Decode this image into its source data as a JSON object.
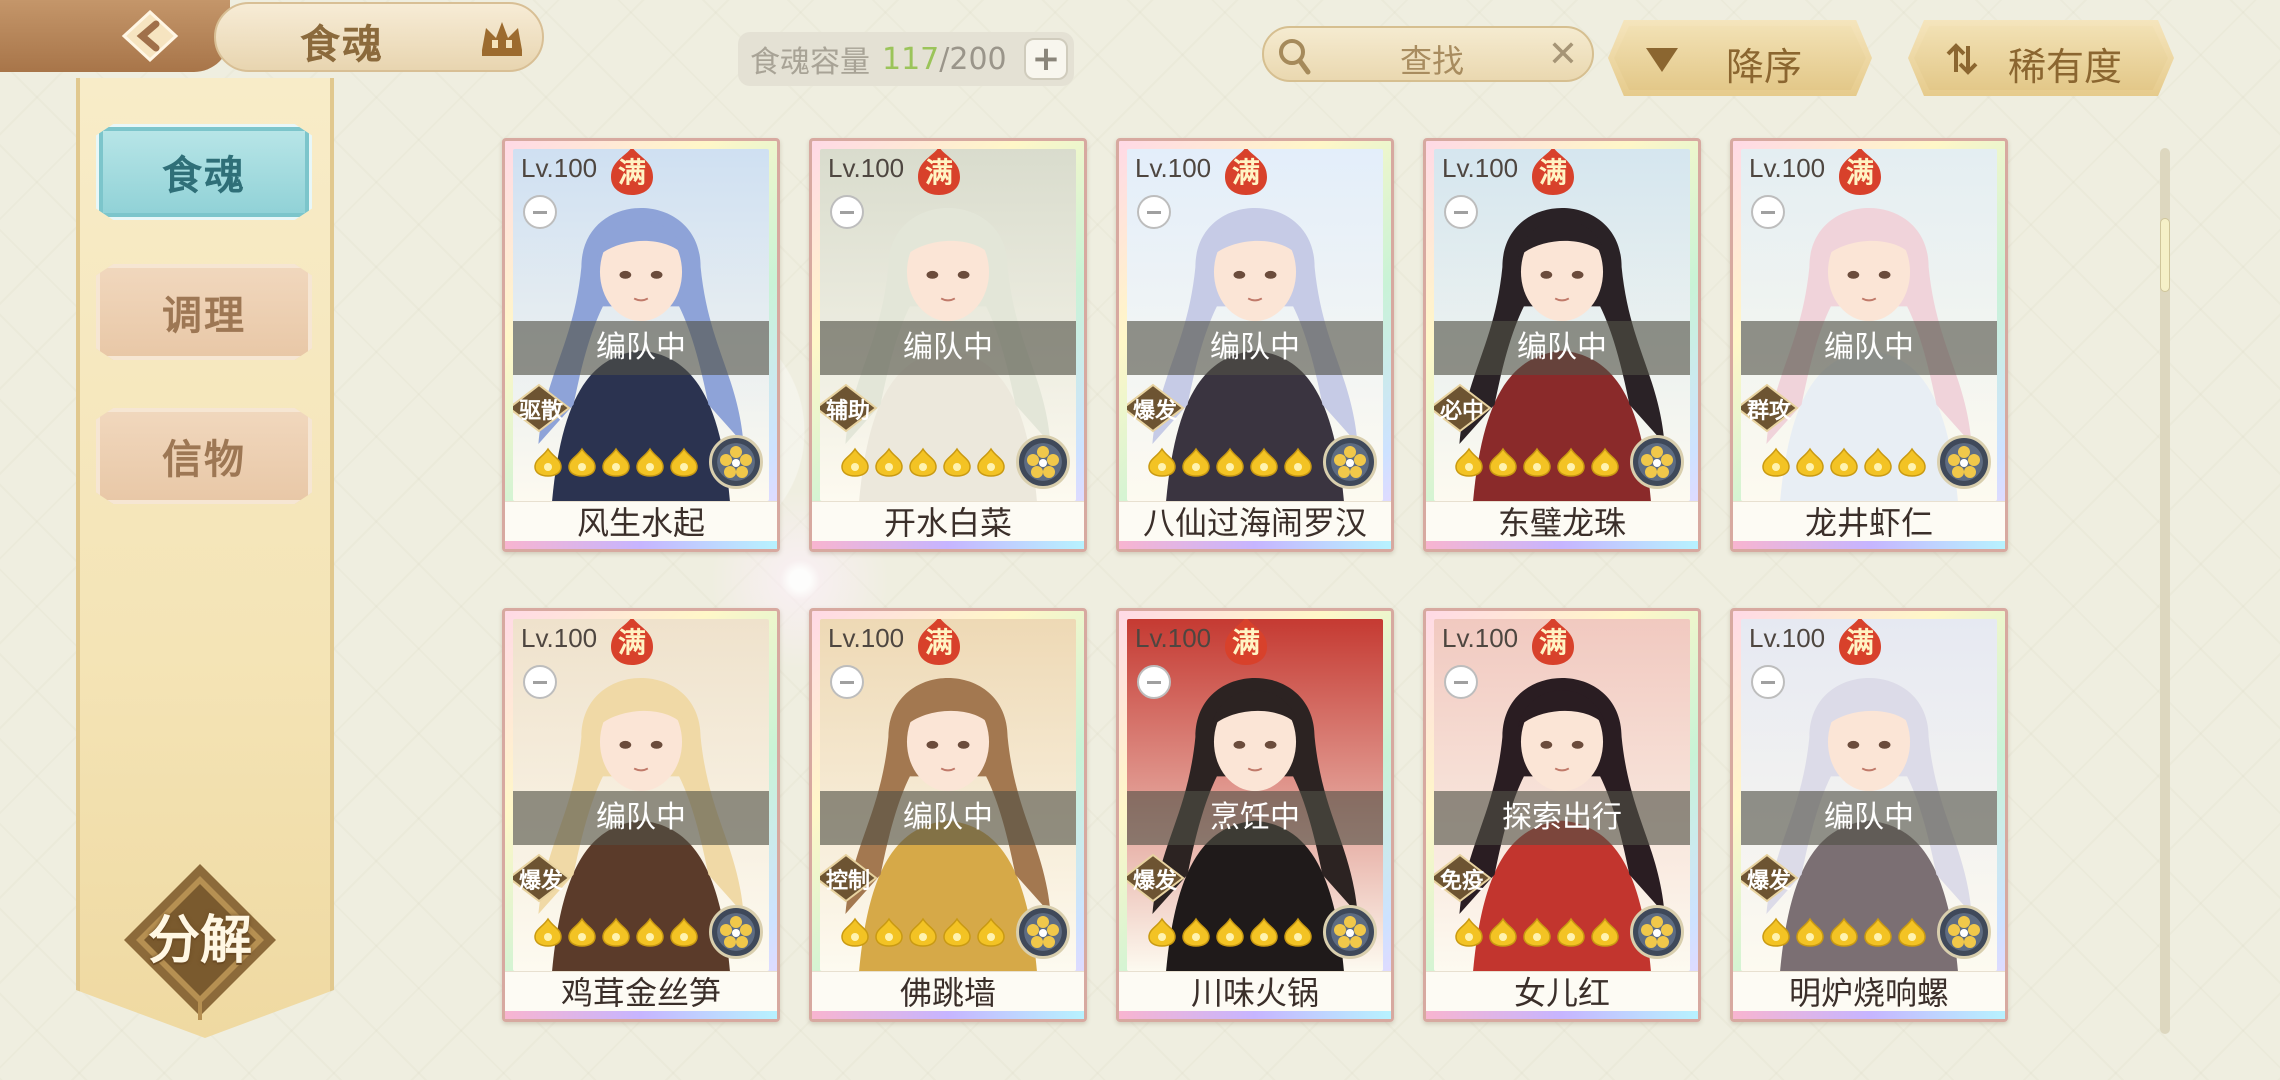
{
  "header": {
    "title": "食魂",
    "capacity_label": "食魂容量",
    "capacity_current": "117",
    "capacity_sep": "/",
    "capacity_max": "200",
    "capacity_plus": "+",
    "search_placeholder": "查找",
    "clear": "✕",
    "sort_label": "降序",
    "filter_label": "稀有度"
  },
  "sidebar": {
    "tabs": [
      {
        "label": "食魂",
        "active": true
      },
      {
        "label": "调理",
        "active": false
      },
      {
        "label": "信物",
        "active": false
      }
    ],
    "decompose_label": "分解"
  },
  "cards": [
    {
      "level": "Lv.100",
      "badge": "满",
      "status": "编队中",
      "role": "驱散",
      "name": "风生水起",
      "stars": 5,
      "hair": "#8ea3d8",
      "bg": "#cfe0f2",
      "coat": "#2b3350"
    },
    {
      "level": "Lv.100",
      "badge": "满",
      "status": "编队中",
      "role": "辅助",
      "name": "开水白菜",
      "stars": 5,
      "hair": "#e3e6d8",
      "bg": "#d9dccd",
      "coat": "#ece8dc"
    },
    {
      "level": "Lv.100",
      "badge": "满",
      "status": "编队中",
      "role": "爆发",
      "name": "八仙过海闹罗汉",
      "stars": 5,
      "hair": "#c6cbe6",
      "bg": "#e3eefa",
      "coat": "#3a3440"
    },
    {
      "level": "Lv.100",
      "badge": "满",
      "status": "编队中",
      "role": "必中",
      "name": "东璧龙珠",
      "stars": 5,
      "hair": "#2a2226",
      "bg": "#d5e6ef",
      "coat": "#8a2a2a"
    },
    {
      "level": "Lv.100",
      "badge": "满",
      "status": "编队中",
      "role": "群攻",
      "name": "龙井虾仁",
      "stars": 5,
      "hair": "#f0d3da",
      "bg": "#e4eef2",
      "coat": "#e8eef4"
    },
    {
      "level": "Lv.100",
      "badge": "满",
      "status": "编队中",
      "role": "爆发",
      "name": "鸡茸金丝笋",
      "stars": 5,
      "hair": "#f0d9a6",
      "bg": "#efe2cc",
      "coat": "#5b3b2a"
    },
    {
      "level": "Lv.100",
      "badge": "满",
      "status": "编队中",
      "role": "控制",
      "name": "佛跳墙",
      "stars": 5,
      "hair": "#a37850",
      "bg": "#eed9b5",
      "coat": "#d6a948"
    },
    {
      "level": "Lv.100",
      "badge": "满",
      "status": "烹饪中",
      "role": "爆发",
      "name": "川味火锅",
      "stars": 5,
      "hair": "#2c2322",
      "bg": "#c53a32",
      "coat": "#1f1a1a"
    },
    {
      "level": "Lv.100",
      "badge": "满",
      "status": "探索出行",
      "role": "免疫",
      "name": "女儿红",
      "stars": 5,
      "hair": "#2a1d22",
      "bg": "#f1c9c0",
      "coat": "#c2352e"
    },
    {
      "level": "Lv.100",
      "badge": "满",
      "status": "编队中",
      "role": "爆发",
      "name": "明炉烧响螺",
      "stars": 5,
      "hair": "#dcdbe8",
      "bg": "#e6e9f2",
      "coat": "#7b6f73"
    }
  ]
}
